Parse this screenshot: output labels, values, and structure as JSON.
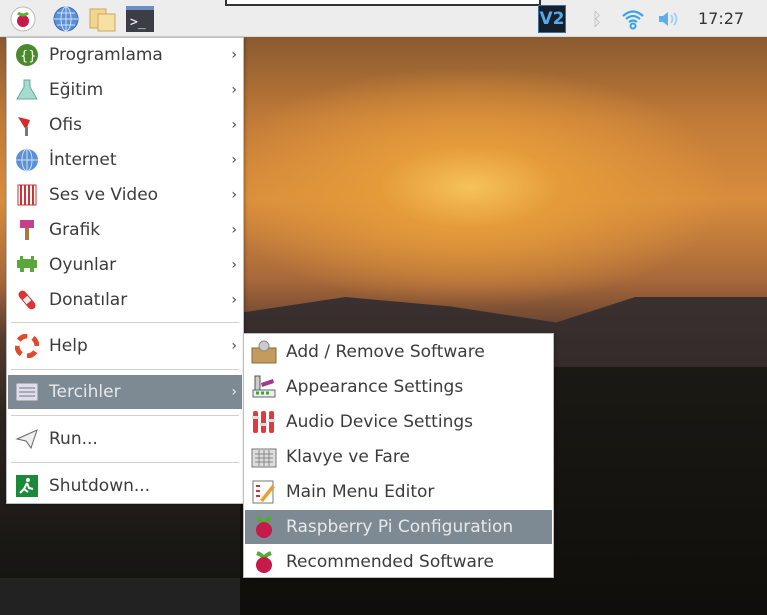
{
  "panel": {
    "clock": "17:27",
    "icons": [
      "raspberry-menu-icon",
      "web-browser-icon",
      "file-manager-icon",
      "terminal-icon",
      "vnc-icon",
      "bluetooth-icon",
      "wifi-icon",
      "volume-icon"
    ]
  },
  "main_menu": {
    "items": [
      {
        "label": "Programlama",
        "icon": "programming-icon"
      },
      {
        "label": "Eğitim",
        "icon": "education-icon"
      },
      {
        "label": "Ofis",
        "icon": "office-icon"
      },
      {
        "label": "İnternet",
        "icon": "internet-icon"
      },
      {
        "label": "Ses ve Video",
        "icon": "sound-video-icon"
      },
      {
        "label": "Grafik",
        "icon": "graphics-icon"
      },
      {
        "label": "Oyunlar",
        "icon": "games-icon"
      },
      {
        "label": "Donatılar",
        "icon": "accessories-icon"
      },
      {
        "label": "Help",
        "icon": "help-icon"
      },
      {
        "label": "Tercihler",
        "icon": "preferences-icon"
      },
      {
        "label": "Run...",
        "icon": "run-icon"
      },
      {
        "label": "Shutdown...",
        "icon": "shutdown-icon"
      }
    ]
  },
  "sub_menu": {
    "items": [
      {
        "label": "Add / Remove Software"
      },
      {
        "label": "Appearance Settings"
      },
      {
        "label": "Audio Device Settings"
      },
      {
        "label": "Klavye ve Fare"
      },
      {
        "label": "Main Menu Editor"
      },
      {
        "label": "Raspberry Pi Configuration"
      },
      {
        "label": "Recommended Software"
      }
    ]
  }
}
